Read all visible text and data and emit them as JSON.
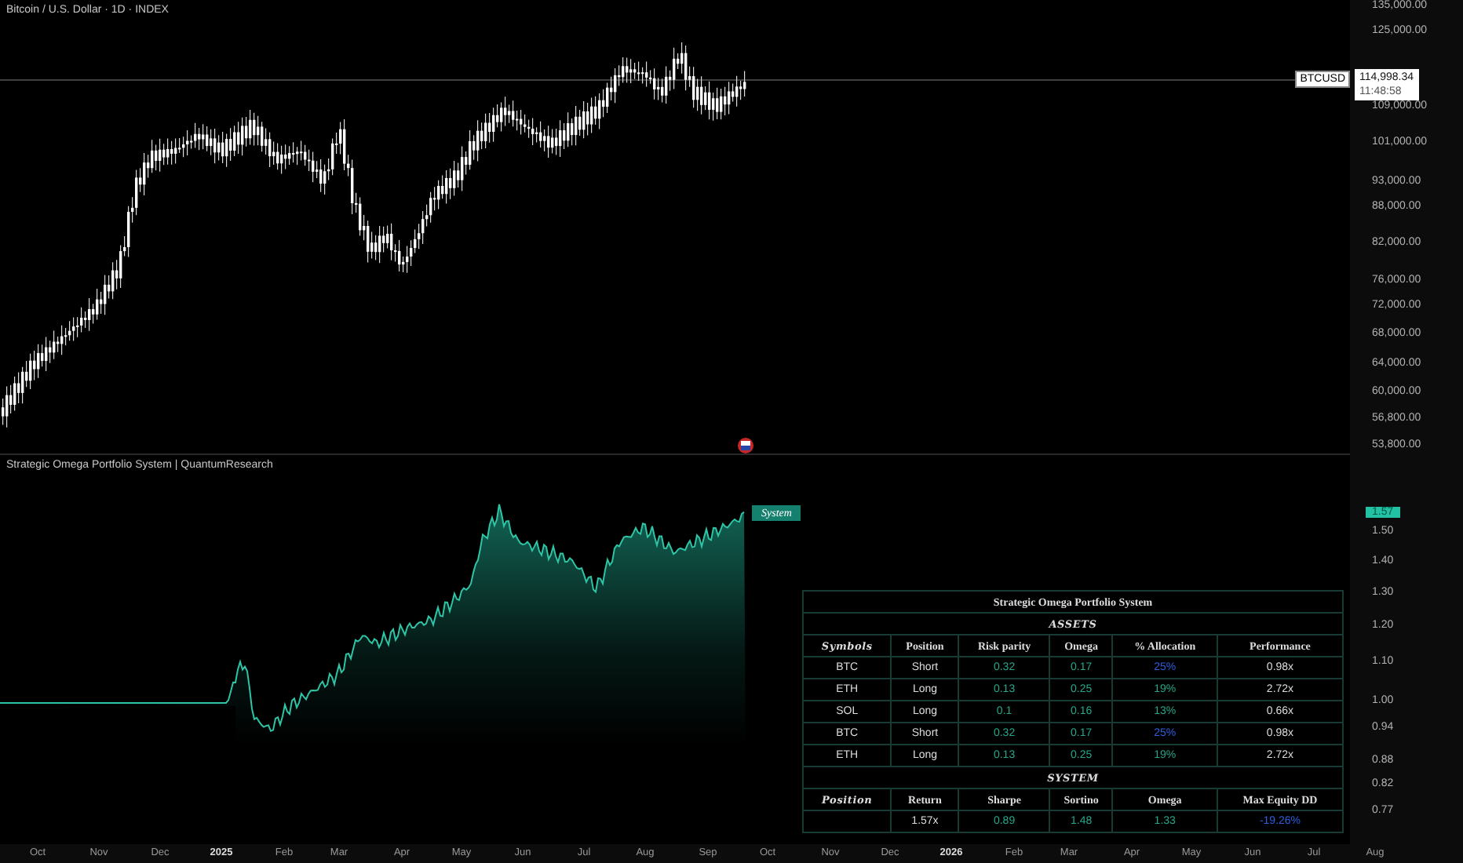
{
  "title": "Bitcoin / U.S. Dollar · 1D · INDEX",
  "price_axis": {
    "labels": [
      "135,000.00",
      "125,000.00",
      "109,000.00",
      "101,000.00",
      "93,000.00",
      "88,000.00",
      "82,000.00",
      "76,000.00",
      "72,000.00",
      "68,000.00",
      "64,000.00",
      "60,000.00",
      "56,800.00",
      "53,800.00"
    ],
    "symbol_tag": "BTCUSD",
    "price": "114,998.34",
    "countdown": "11:48:58"
  },
  "indicator": {
    "title": "Strategic Omega Portfolio System | QuantumResearch",
    "series_tag": "System",
    "current_value": "1.57",
    "axis_labels": [
      "1.50",
      "1.40",
      "1.30",
      "1.20",
      "1.10",
      "1.00",
      "0.94",
      "0.88",
      "0.82",
      "0.77"
    ]
  },
  "table": {
    "title": "Strategic Omega Portfolio System",
    "assets_heading": "ASSETS",
    "asset_columns": [
      "Symbols",
      "Position",
      "Risk parity",
      "Omega",
      "% Allocation",
      "Performance"
    ],
    "asset_rows": [
      {
        "symbol": "BTC",
        "position": "Short",
        "risk_parity": "0.32",
        "omega": "0.17",
        "allocation": "25%",
        "color": "#2f5fe0",
        "performance": "0.98x"
      },
      {
        "symbol": "ETH",
        "position": "Long",
        "risk_parity": "0.13",
        "omega": "0.25",
        "allocation": "19%",
        "color": "#26a68a",
        "performance": "2.72x"
      },
      {
        "symbol": "SOL",
        "position": "Long",
        "risk_parity": "0.1",
        "omega": "0.16",
        "allocation": "13%",
        "color": "#26a68a",
        "performance": "0.66x"
      },
      {
        "symbol": "BTC",
        "position": "Short",
        "risk_parity": "0.32",
        "omega": "0.17",
        "allocation": "25%",
        "color": "#2f5fe0",
        "performance": "0.98x"
      },
      {
        "symbol": "ETH",
        "position": "Long",
        "risk_parity": "0.13",
        "omega": "0.25",
        "allocation": "19%",
        "color": "#26a68a",
        "performance": "2.72x"
      }
    ],
    "system_heading": "SYSTEM",
    "system_columns": [
      "Position",
      "Return",
      "Sharpe",
      "Sortino",
      "Omega",
      "Max Equity DD"
    ],
    "system_values": [
      "1.57x",
      "0.89",
      "1.48",
      "1.33",
      "-19.26%"
    ]
  },
  "time_axis": [
    {
      "text": "Oct",
      "year": false
    },
    {
      "text": "Nov",
      "year": false
    },
    {
      "text": "Dec",
      "year": false
    },
    {
      "text": "2025",
      "year": true
    },
    {
      "text": "Feb",
      "year": false
    },
    {
      "text": "Mar",
      "year": false
    },
    {
      "text": "Apr",
      "year": false
    },
    {
      "text": "May",
      "year": false
    },
    {
      "text": "Jun",
      "year": false
    },
    {
      "text": "Jul",
      "year": false
    },
    {
      "text": "Aug",
      "year": false
    },
    {
      "text": "Sep",
      "year": false
    },
    {
      "text": "Oct",
      "year": false
    },
    {
      "text": "Nov",
      "year": false
    },
    {
      "text": "Dec",
      "year": false
    },
    {
      "text": "2026",
      "year": true
    },
    {
      "text": "Feb",
      "year": false
    },
    {
      "text": "Mar",
      "year": false
    },
    {
      "text": "Apr",
      "year": false
    },
    {
      "text": "May",
      "year": false
    },
    {
      "text": "Jun",
      "year": false
    },
    {
      "text": "Jul",
      "year": false
    },
    {
      "text": "Aug",
      "year": false
    }
  ]
}
